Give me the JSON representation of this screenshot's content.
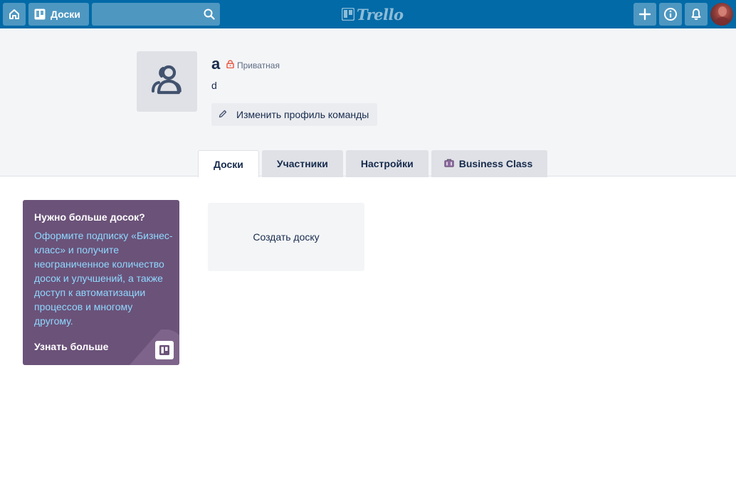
{
  "header": {
    "boards_label": "Доски",
    "logo_text": "Trello",
    "colors": {
      "bar": "#026aa7"
    },
    "icons": [
      "home-icon",
      "boards-icon",
      "search-icon",
      "plus-icon",
      "info-icon",
      "bell-icon"
    ]
  },
  "team": {
    "name": "a",
    "visibility": "Приватная",
    "description": "d",
    "edit_label": "Изменить профиль команды",
    "icons": [
      "team-members-icon",
      "lock-icon",
      "pencil-icon"
    ]
  },
  "tabs": [
    {
      "label": "Доски",
      "active": true
    },
    {
      "label": "Участники",
      "active": false
    },
    {
      "label": "Настройки",
      "active": false
    },
    {
      "label": "Business Class",
      "active": false,
      "icon": "briefcase-icon"
    }
  ],
  "promo": {
    "title": "Нужно больше досок?",
    "text": "Оформите подписку «Бизнес-класс» и получите неограниченное количество досок и улучшений, а также доступ к автоматизации процессов и многому другому.",
    "link": "Узнать больше",
    "colors": {
      "background": "#6b5279",
      "text": "#8fd8ff"
    }
  },
  "boards": {
    "create_label": "Создать доску"
  }
}
